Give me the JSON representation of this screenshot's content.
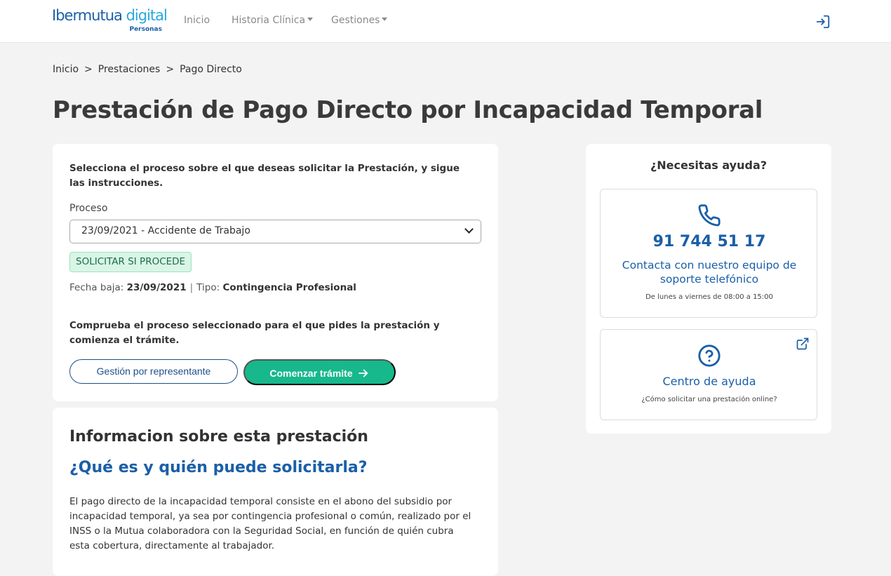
{
  "brand": {
    "name_main": "Ibermutua",
    "name_accent": "digital",
    "sub": "Personas",
    "accent": "#2aa8e0",
    "primary": "#1a5fa8"
  },
  "nav": {
    "items": [
      "Inicio",
      "Historia Clínica",
      "Gestiones"
    ]
  },
  "breadcrumb": [
    "Inicio",
    "Prestaciones",
    "Pago Directo"
  ],
  "page_title": "Prestación de Pago Directo por Incapacidad Temporal",
  "process_card": {
    "instruction": "Selecciona el proceso sobre el que deseas solicitar la Prestación, y sigue las instrucciones.",
    "label": "Proceso",
    "selected": "23/09/2021 - Accidente de Trabajo",
    "badge": "SOLICITAR SI PROCEDE",
    "fecha_label": "Fecha baja:",
    "fecha_value": "23/09/2021",
    "tipo_label": "Tipo:",
    "tipo_value": "Contingencia Profesional",
    "check_text": "Comprueba el proceso seleccionado para el que pides la prestación y comienza el trámite.",
    "btn_representante": "Gestión por representante",
    "btn_comenzar": "Comenzar trámite",
    "success_color": "#17b88c"
  },
  "info_card": {
    "title": "Informacion sobre esta prestación",
    "subtitle": "¿Qué es y quién puede solicitarla?",
    "body": "El pago directo de la incapacidad temporal consiste en el abono del subsidio por incapacidad temporal, ya sea por contingencia profesional o común, realizado por el INSS o la Mutua colaboradora con la Seguridad Social, en función de quién cubra esta cobertura, directamente al trabajador."
  },
  "help": {
    "title": "¿Necesitas ayuda?",
    "phone": "91 744 51 17",
    "phone_desc": "Contacta con nuestro equipo de soporte telefónico",
    "hours": "De lunes a viernes de 08:00 a 15:00",
    "center_title": "Centro de ayuda",
    "center_desc": "¿Cómo solicitar una prestación online?"
  }
}
